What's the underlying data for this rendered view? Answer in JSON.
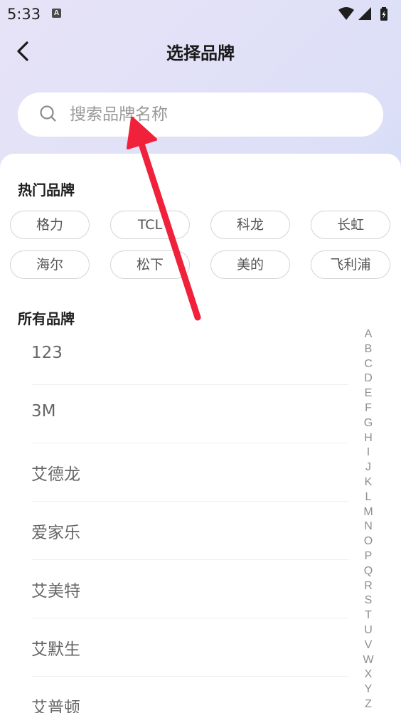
{
  "status_bar": {
    "time": "5:33",
    "badge": "A"
  },
  "header": {
    "title": "选择品牌"
  },
  "search": {
    "placeholder": "搜索品牌名称"
  },
  "hot_section": {
    "title": "热门品牌",
    "items": [
      "格力",
      "TCL",
      "科龙",
      "长虹",
      "海尔",
      "松下",
      "美的",
      "飞利浦"
    ]
  },
  "all_section": {
    "title": "所有品牌",
    "items": [
      "123",
      "3M",
      "艾德龙",
      "爱家乐",
      "艾美特",
      "艾默生",
      "艾普顿"
    ]
  },
  "index_letters": [
    "A",
    "B",
    "C",
    "D",
    "E",
    "F",
    "G",
    "H",
    "I",
    "J",
    "K",
    "L",
    "M",
    "N",
    "O",
    "P",
    "Q",
    "R",
    "S",
    "T",
    "U",
    "V",
    "W",
    "X",
    "Y",
    "Z"
  ],
  "annotation": {
    "arrow_color": "#f0213a"
  }
}
